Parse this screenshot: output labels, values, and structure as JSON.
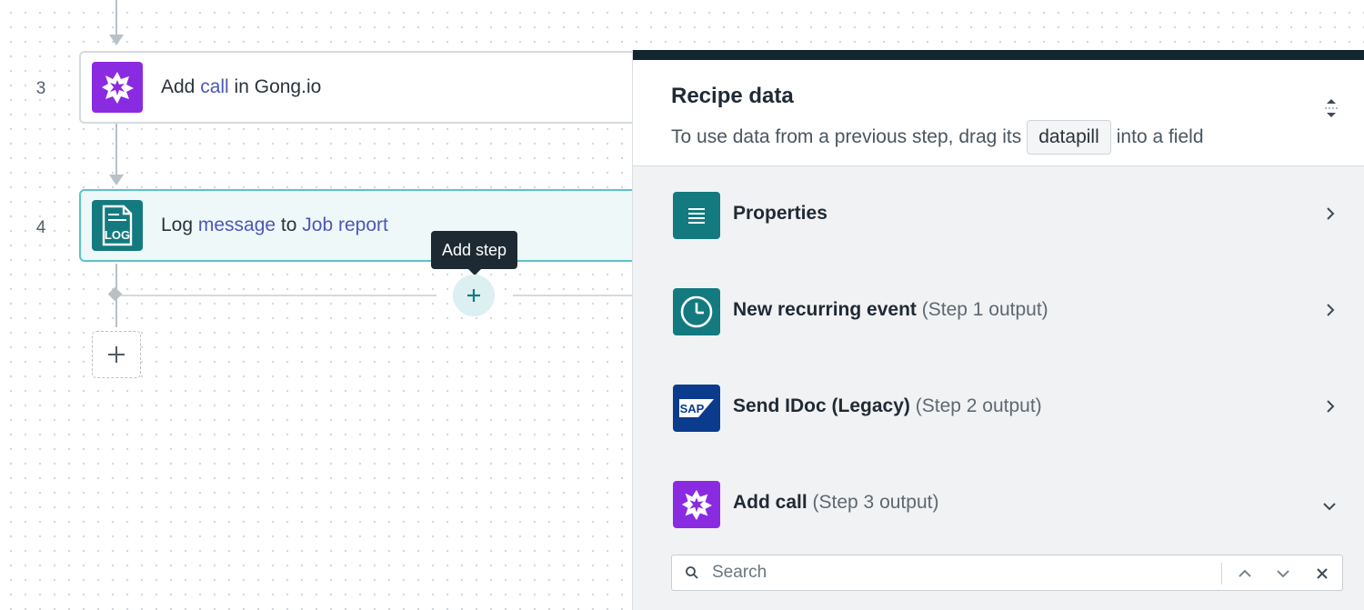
{
  "canvas": {
    "steps": [
      {
        "number": "3",
        "parts": [
          {
            "text": "Add ",
            "link": false
          },
          {
            "text": "call",
            "link": true
          },
          {
            "text": " in Gong.io",
            "link": false
          }
        ],
        "icon": "gong-icon"
      },
      {
        "number": "4",
        "parts": [
          {
            "text": "Log ",
            "link": false
          },
          {
            "text": "message",
            "link": true
          },
          {
            "text": " to ",
            "link": false
          },
          {
            "text": "Job report",
            "link": true
          }
        ],
        "icon": "log-icon",
        "icon_text": "LOG"
      }
    ],
    "tooltip": "Add step",
    "add_step_icon": "plus-icon",
    "add_box_icon": "plus-icon"
  },
  "panel": {
    "title": "Recipe data",
    "subtitle_before": "To use data from a previous step, drag its",
    "pill": "datapill",
    "subtitle_after": "into a field",
    "sections": [
      {
        "label": "Properties",
        "suffix": "",
        "icon": "list-icon",
        "chevron": "chevron-right-icon"
      },
      {
        "label": "New recurring event",
        "suffix": "(Step 1 output)",
        "icon": "clock-icon",
        "chevron": "chevron-right-icon"
      },
      {
        "label": "Send IDoc (Legacy)",
        "suffix": "(Step 2 output)",
        "icon": "sap-icon",
        "icon_text": "SAP",
        "chevron": "chevron-right-icon"
      },
      {
        "label": "Add call",
        "suffix": "(Step 3 output)",
        "icon": "gong-icon",
        "chevron": "chevron-down-icon"
      }
    ],
    "search": {
      "placeholder": "Search",
      "value": ""
    }
  },
  "colors": {
    "accent_teal": "#137a80",
    "gong_purple": "#8a2be2",
    "sap_blue": "#0b3b8c",
    "link": "#4b57b8",
    "panel_bar": "#12262f"
  }
}
